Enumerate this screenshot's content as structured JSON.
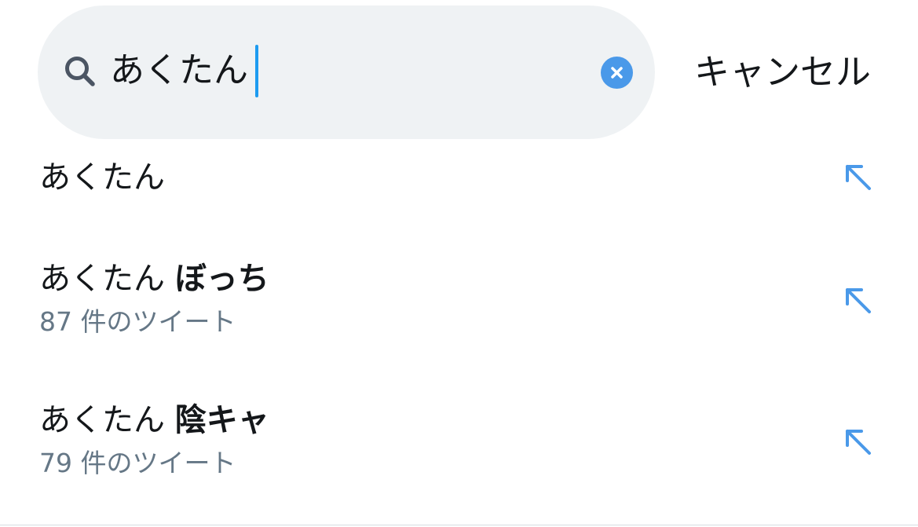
{
  "search": {
    "query": "あくたん",
    "clear_icon": "close-circle-icon",
    "search_icon": "magnifying-glass-icon",
    "accent_color": "#1d9bf0"
  },
  "cancel_label": "キャンセル",
  "suggestions": [
    {
      "prefix": "あくたん",
      "bold": "",
      "subtitle": "",
      "icon": "arrow-up-left-icon"
    },
    {
      "prefix": "あくたん ",
      "bold": "ぼっち",
      "subtitle": "87 件のツイート",
      "icon": "arrow-up-left-icon"
    },
    {
      "prefix": "あくたん ",
      "bold": "陰キャ",
      "subtitle": "79 件のツイート",
      "icon": "arrow-up-left-icon"
    }
  ]
}
